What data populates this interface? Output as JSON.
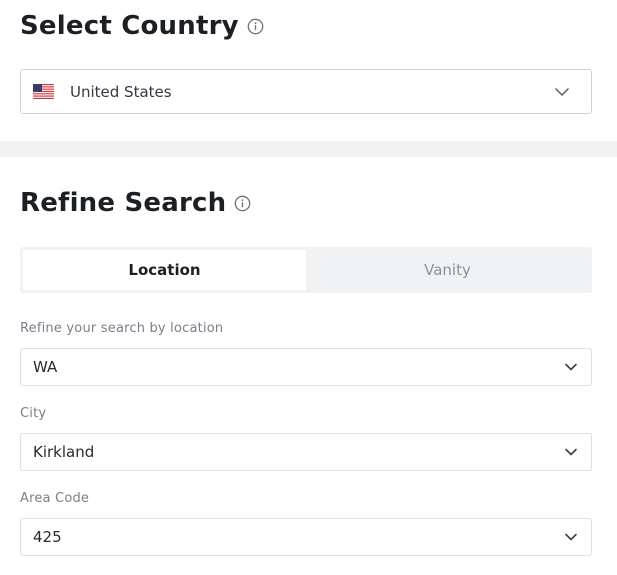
{
  "select_country": {
    "title": "Select Country",
    "info_icon": "info-circle-icon",
    "selected_country": "United States",
    "flag_icon": "us-flag-icon",
    "dropdown_icon": "chevron-down-icon"
  },
  "refine_search": {
    "title": "Refine Search",
    "info_icon": "info-circle-icon",
    "tabs": [
      {
        "label": "Location",
        "active": true
      },
      {
        "label": "Vanity",
        "active": false
      }
    ],
    "fields": [
      {
        "label": "Refine your search by location",
        "value": "WA"
      },
      {
        "label": "City",
        "value": "Kirkland"
      },
      {
        "label": "Area Code",
        "value": "425"
      }
    ]
  },
  "colors": {
    "heading": "#1c1f24",
    "muted_label": "#7a8089",
    "border": "#dcdfe3",
    "section_divider": "#f1f2f4",
    "tab_track": "#f1f2f4"
  }
}
